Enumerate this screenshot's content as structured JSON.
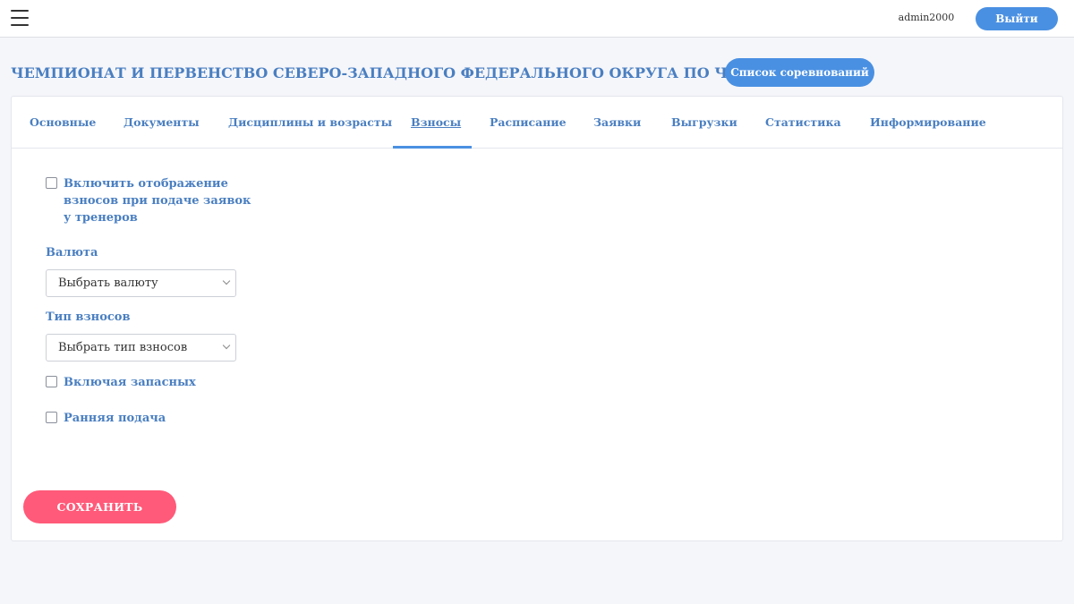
{
  "topbar": {
    "menu_icon": "hamburger-menu-icon",
    "username": "admin2000",
    "logout_label": "Выйти"
  },
  "header": {
    "title": "ЧЕМПИОНАТ И ПЕРВЕНСТВО СЕВЕРО-ЗАПАДНОГО ФЕДЕРАЛЬНОГО ОКРУГА ПО ЧИР СПОРТУ",
    "competitions_button": "Список соревнований"
  },
  "tabs": [
    {
      "label": "Основные"
    },
    {
      "label": "Документы"
    },
    {
      "label": "Дисциплины и возрасты"
    },
    {
      "label": "Взносы",
      "active": true
    },
    {
      "label": "Расписание"
    },
    {
      "label": "Заявки"
    },
    {
      "label": "Выгрузки"
    },
    {
      "label": "Статистика"
    },
    {
      "label": "Информирование"
    }
  ],
  "form": {
    "show_fees_checkbox": {
      "label": "Включить отображение взносов при подаче заявок у тренеров",
      "checked": false
    },
    "currency": {
      "label": "Валюта",
      "value": "Выбрать валюту"
    },
    "fee_type": {
      "label": "Тип взносов",
      "value": "Выбрать тип взносов"
    },
    "include_reserves_checkbox": {
      "label": "Включая запасных",
      "checked": false
    },
    "early_submission_checkbox": {
      "label": "Ранняя подача",
      "checked": false
    },
    "save_label": "СОХРАНИТЬ"
  },
  "colors": {
    "accent": "#4a90e2",
    "label": "#4a7fc1",
    "save": "#ff5a79",
    "background": "#f5f6fa"
  }
}
